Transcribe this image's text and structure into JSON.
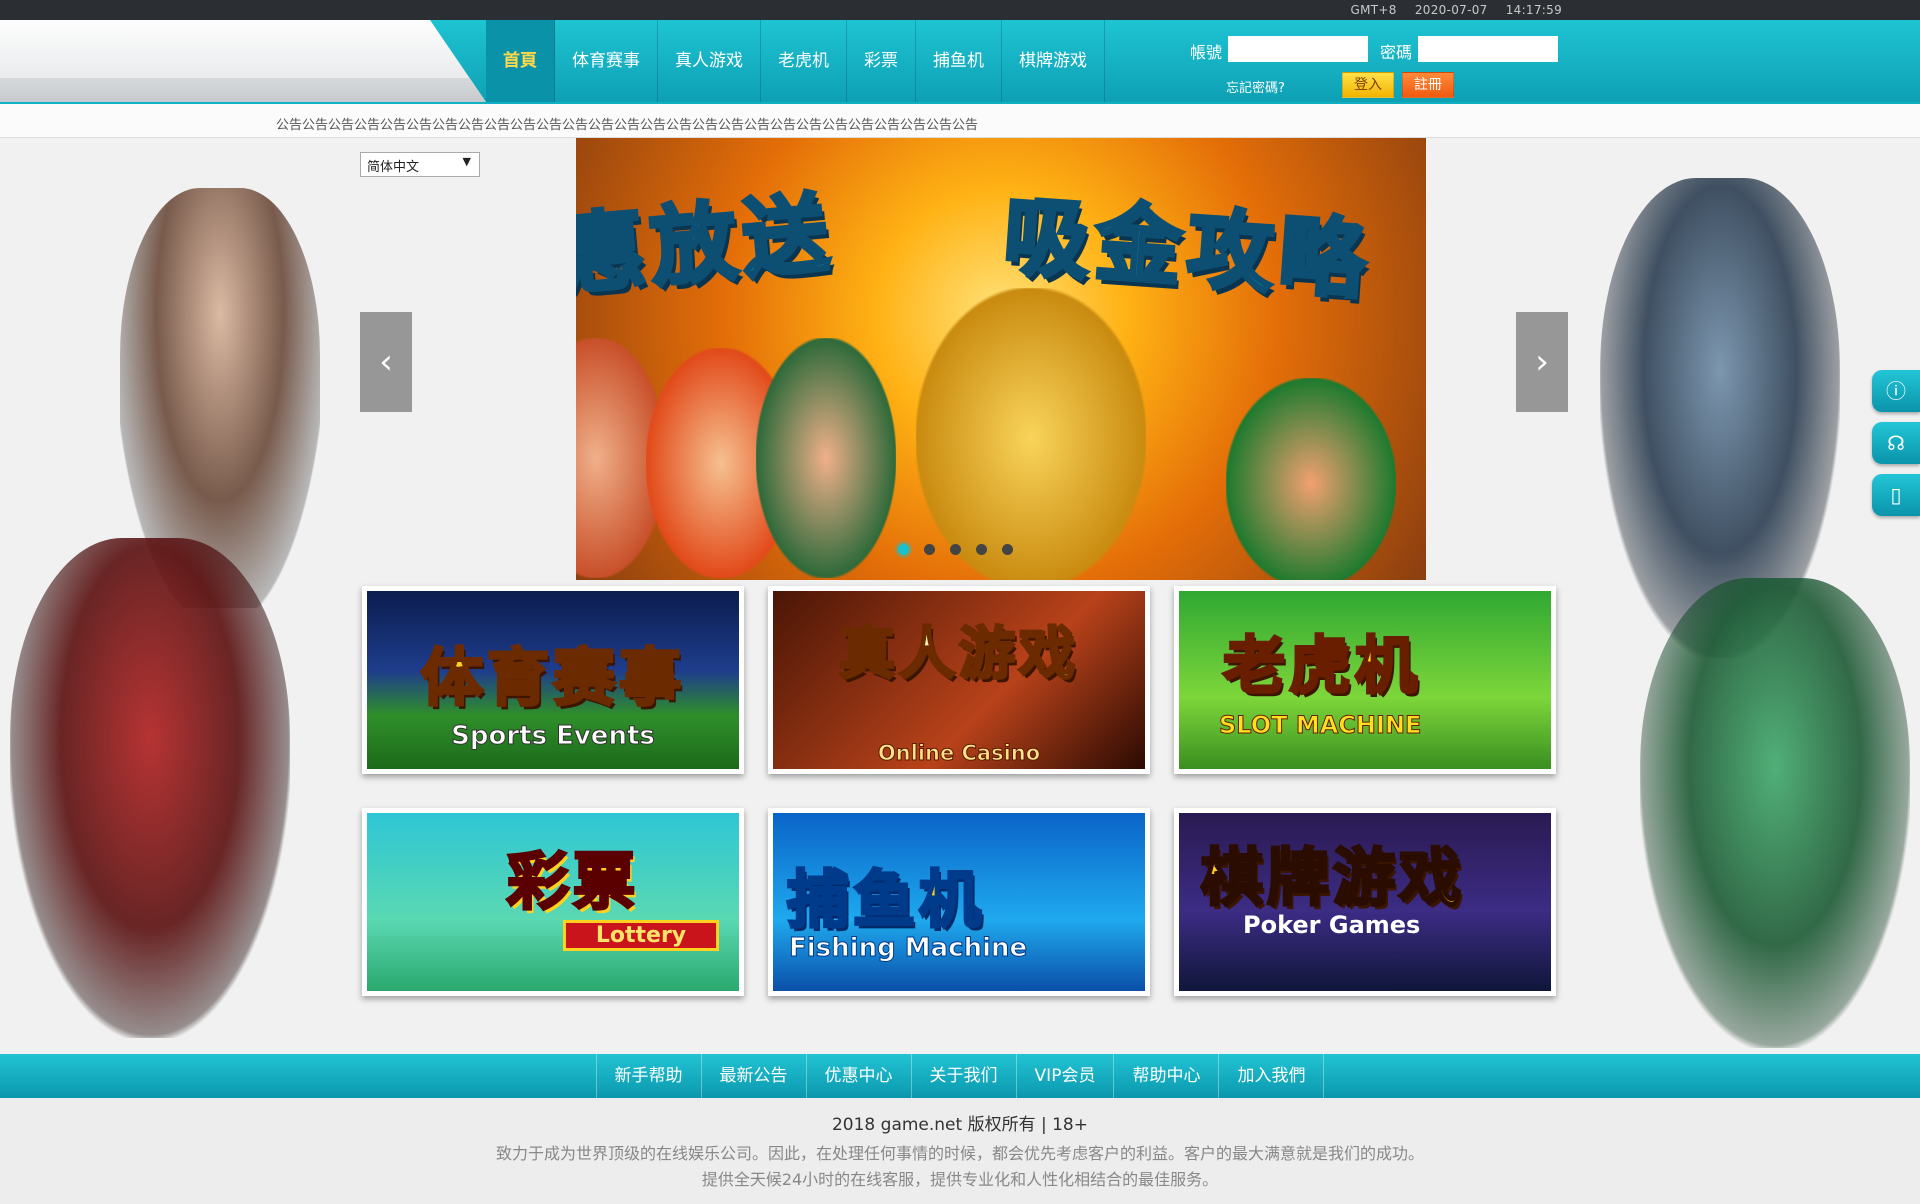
{
  "topbar": {
    "timezone": "GMT+8",
    "date": "2020-07-07",
    "time": "14:17:59"
  },
  "nav": {
    "items": [
      {
        "label": "首頁",
        "active": true
      },
      {
        "label": "体育赛事"
      },
      {
        "label": "真人游戏"
      },
      {
        "label": "老虎机"
      },
      {
        "label": "彩票"
      },
      {
        "label": "捕鱼机"
      },
      {
        "label": "棋牌游戏"
      }
    ]
  },
  "login": {
    "account_label": "帳號",
    "account_value": "",
    "password_label": "密碼",
    "password_value": "",
    "forgot_label": "忘記密碼?",
    "login_button": "登入",
    "register_button": "註冊"
  },
  "notice": {
    "text": "公告公告公告公告公告公告公告公告公告公告公告公告公告公告公告公告公告公告公告公告公告公告公告公告公告公告公告"
  },
  "language": {
    "selected": "简体中文"
  },
  "banner": {
    "title_left": "特惠放送",
    "title_right": "吸金攻略",
    "prev_icon": "‹",
    "next_icon": "›",
    "slide_count": 5,
    "active_slide": 1
  },
  "games": {
    "sports": {
      "zh": "体育赛事",
      "en": "Sports Events"
    },
    "casino": {
      "zh": "真人游戏",
      "en": "Online Casino"
    },
    "slot": {
      "zh": "老虎机",
      "en": "SLOT MACHINE"
    },
    "lottery": {
      "zh": "彩票",
      "en": "Lottery"
    },
    "fish": {
      "zh": "捕鱼机",
      "en": "Fishing Machine"
    },
    "poker": {
      "zh": "棋牌游戏",
      "en": "Poker Games"
    }
  },
  "side_icons": [
    "info-icon",
    "headset-icon",
    "mobile-icon"
  ],
  "footer_nav": [
    "新手帮助",
    "最新公告",
    "优惠中心",
    "关于我们",
    "VIP会员",
    "帮助中心",
    "加入我們"
  ],
  "footer": {
    "copyright": "2018 game.net 版权所有 | 18+",
    "line1": "致力于成为世界顶级的在线娱乐公司。因此，在处理任何事情的时候，都会优先考虑客户的利益。客户的最大满意就是我们的成功。",
    "line2": "提供全天候24小时的在线客服，提供专业化和人性化相结合的最佳服务。"
  },
  "colors": {
    "accent": "#16b4c6",
    "accent_dark": "#0a94aa",
    "topbar": "#2b2f33",
    "active_nav_text": "#ffd94a"
  }
}
